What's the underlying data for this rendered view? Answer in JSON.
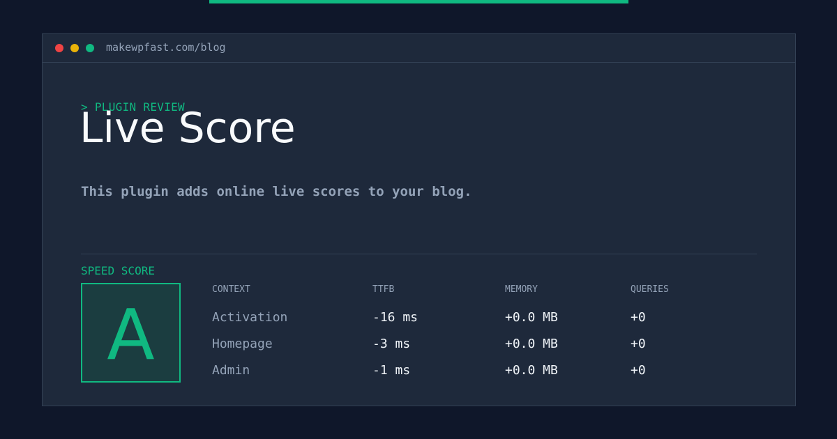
{
  "colors": {
    "background": "#0f172a",
    "panel": "#1e293b",
    "accent": "#10b981",
    "muted_text": "#94a3b8",
    "bright_text": "#f8fafc",
    "traffic_red": "#ef4444",
    "traffic_yellow": "#eab308",
    "traffic_green": "#10b981"
  },
  "window": {
    "url": "makewpfast.com/blog",
    "controls": [
      "close-dot",
      "minimize-dot",
      "maximize-dot"
    ]
  },
  "header": {
    "eyebrow": "> PLUGIN REVIEW",
    "title": "Live Score",
    "description": "This plugin adds online live scores to your blog."
  },
  "speed": {
    "label": "SPEED SCORE",
    "grade": "A",
    "columns": [
      "CONTEXT",
      "TTFB",
      "MEMORY",
      "QUERIES"
    ],
    "rows": [
      {
        "context": "Activation",
        "ttfb": "-16 ms",
        "memory": "+0.0 MB",
        "queries": "+0"
      },
      {
        "context": "Homepage",
        "ttfb": "-3 ms",
        "memory": "+0.0 MB",
        "queries": "+0"
      },
      {
        "context": "Admin",
        "ttfb": "-1 ms",
        "memory": "+0.0 MB",
        "queries": "+0"
      }
    ]
  }
}
